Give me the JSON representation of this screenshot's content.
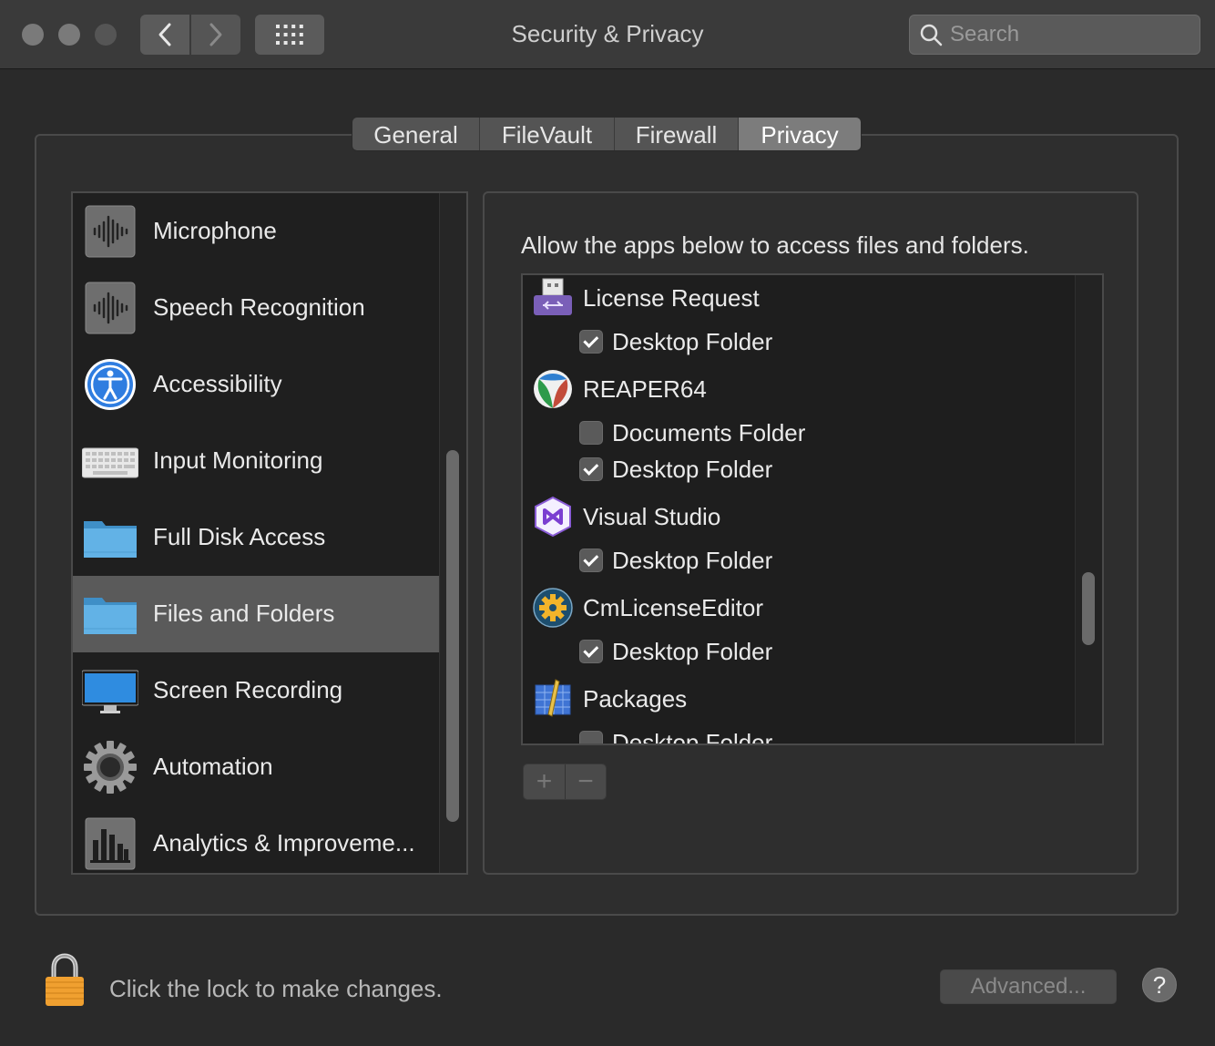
{
  "window": {
    "title": "Security & Privacy",
    "search_placeholder": "Search"
  },
  "tabs": [
    {
      "label": "General"
    },
    {
      "label": "FileVault"
    },
    {
      "label": "Firewall"
    },
    {
      "label": "Privacy",
      "selected": true
    }
  ],
  "sidebar": {
    "items": [
      {
        "label": "Microphone",
        "icon": "microphone-waveform-icon"
      },
      {
        "label": "Speech Recognition",
        "icon": "speech-waveform-icon"
      },
      {
        "label": "Accessibility",
        "icon": "accessibility-icon"
      },
      {
        "label": "Input Monitoring",
        "icon": "keyboard-icon"
      },
      {
        "label": "Full Disk Access",
        "icon": "folder-icon"
      },
      {
        "label": "Files and Folders",
        "icon": "folder-icon",
        "selected": true
      },
      {
        "label": "Screen Recording",
        "icon": "display-icon"
      },
      {
        "label": "Automation",
        "icon": "gear-icon"
      },
      {
        "label": "Analytics & Improveme...",
        "icon": "analytics-chart-icon"
      }
    ]
  },
  "content": {
    "description": "Allow the apps below to access files and folders.",
    "apps": [
      {
        "name": "License Request",
        "icon": "usb-drive-icon",
        "permissions": [
          {
            "label": "Desktop Folder",
            "checked": true
          }
        ]
      },
      {
        "name": "REAPER64",
        "icon": "reaper-icon",
        "permissions": [
          {
            "label": "Documents Folder",
            "checked": false
          },
          {
            "label": "Desktop Folder",
            "checked": true
          }
        ]
      },
      {
        "name": "Visual Studio",
        "icon": "visual-studio-icon",
        "permissions": [
          {
            "label": "Desktop Folder",
            "checked": true
          }
        ]
      },
      {
        "name": "CmLicenseEditor",
        "icon": "cm-license-gear-icon",
        "permissions": [
          {
            "label": "Desktop Folder",
            "checked": true
          }
        ]
      },
      {
        "name": "Packages",
        "icon": "packages-icon",
        "permissions": [
          {
            "label": "Desktop Folder",
            "checked": false
          }
        ]
      }
    ],
    "add_label": "+",
    "remove_label": "−"
  },
  "footer": {
    "lock_text": "Click the lock to make changes.",
    "advanced_label": "Advanced...",
    "help_label": "?"
  },
  "colors": {
    "window_bg": "#2a2a2a",
    "selection": "#5a5a5a",
    "accent_blue": "#4a9be0"
  }
}
